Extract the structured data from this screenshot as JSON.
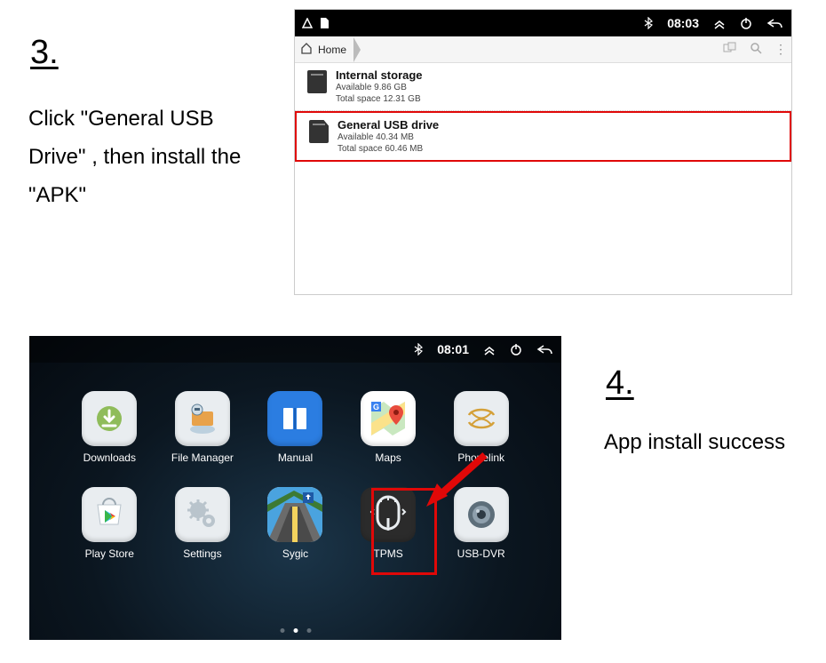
{
  "step3": {
    "number": "3.",
    "instruction": "Click \"General USB Drive\" , then install the \"APK\"",
    "statusbar": {
      "time": "08:03"
    },
    "breadcrumb": {
      "home": "Home"
    },
    "storage": {
      "internal": {
        "title": "Internal storage",
        "available": "Available 9.86 GB",
        "total": "Total space 12.31 GB"
      },
      "usb": {
        "title": "General USB drive",
        "available": "Available 40.34 MB",
        "total": "Total space 60.46 MB"
      }
    }
  },
  "step4": {
    "number": "4.",
    "instruction": "App install success",
    "statusbar": {
      "time": "08:01"
    },
    "apps": {
      "downloads": "Downloads",
      "filemanager": "File Manager",
      "manual": "Manual",
      "maps": "Maps",
      "phonelink": "Phonelink",
      "playstore": "Play Store",
      "settings": "Settings",
      "sygic": "Sygic",
      "tpms": "TPMS",
      "usbdvr": "USB-DVR"
    }
  }
}
